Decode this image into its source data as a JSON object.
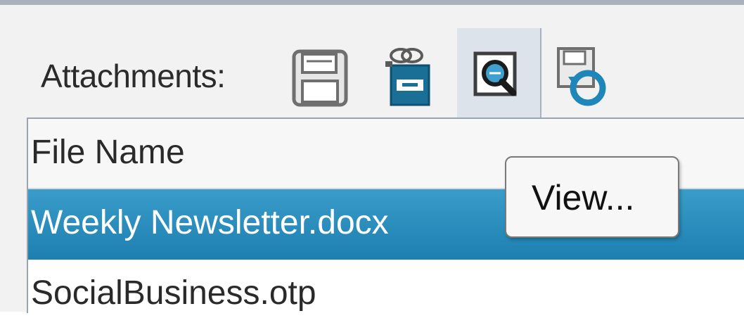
{
  "attachments": {
    "label": "Attachments:",
    "toolbar": [
      {
        "name": "save",
        "icon": "floppy-disk-icon"
      },
      {
        "name": "save-all",
        "icon": "save-attachments-icon"
      },
      {
        "name": "view",
        "icon": "view-magnifier-icon",
        "active": true
      },
      {
        "name": "import",
        "icon": "import-refresh-icon"
      }
    ],
    "table": {
      "header": "File Name",
      "rows": [
        {
          "file_name": "Weekly Newsletter.docx",
          "selected": true
        },
        {
          "file_name": "SocialBusiness.otp",
          "selected": false
        }
      ]
    },
    "tooltip": "View..."
  },
  "colors": {
    "selection": "#2a8fc0",
    "tooltip_border": "#7a7a7a",
    "active_button_bg": "#dde3ea"
  }
}
